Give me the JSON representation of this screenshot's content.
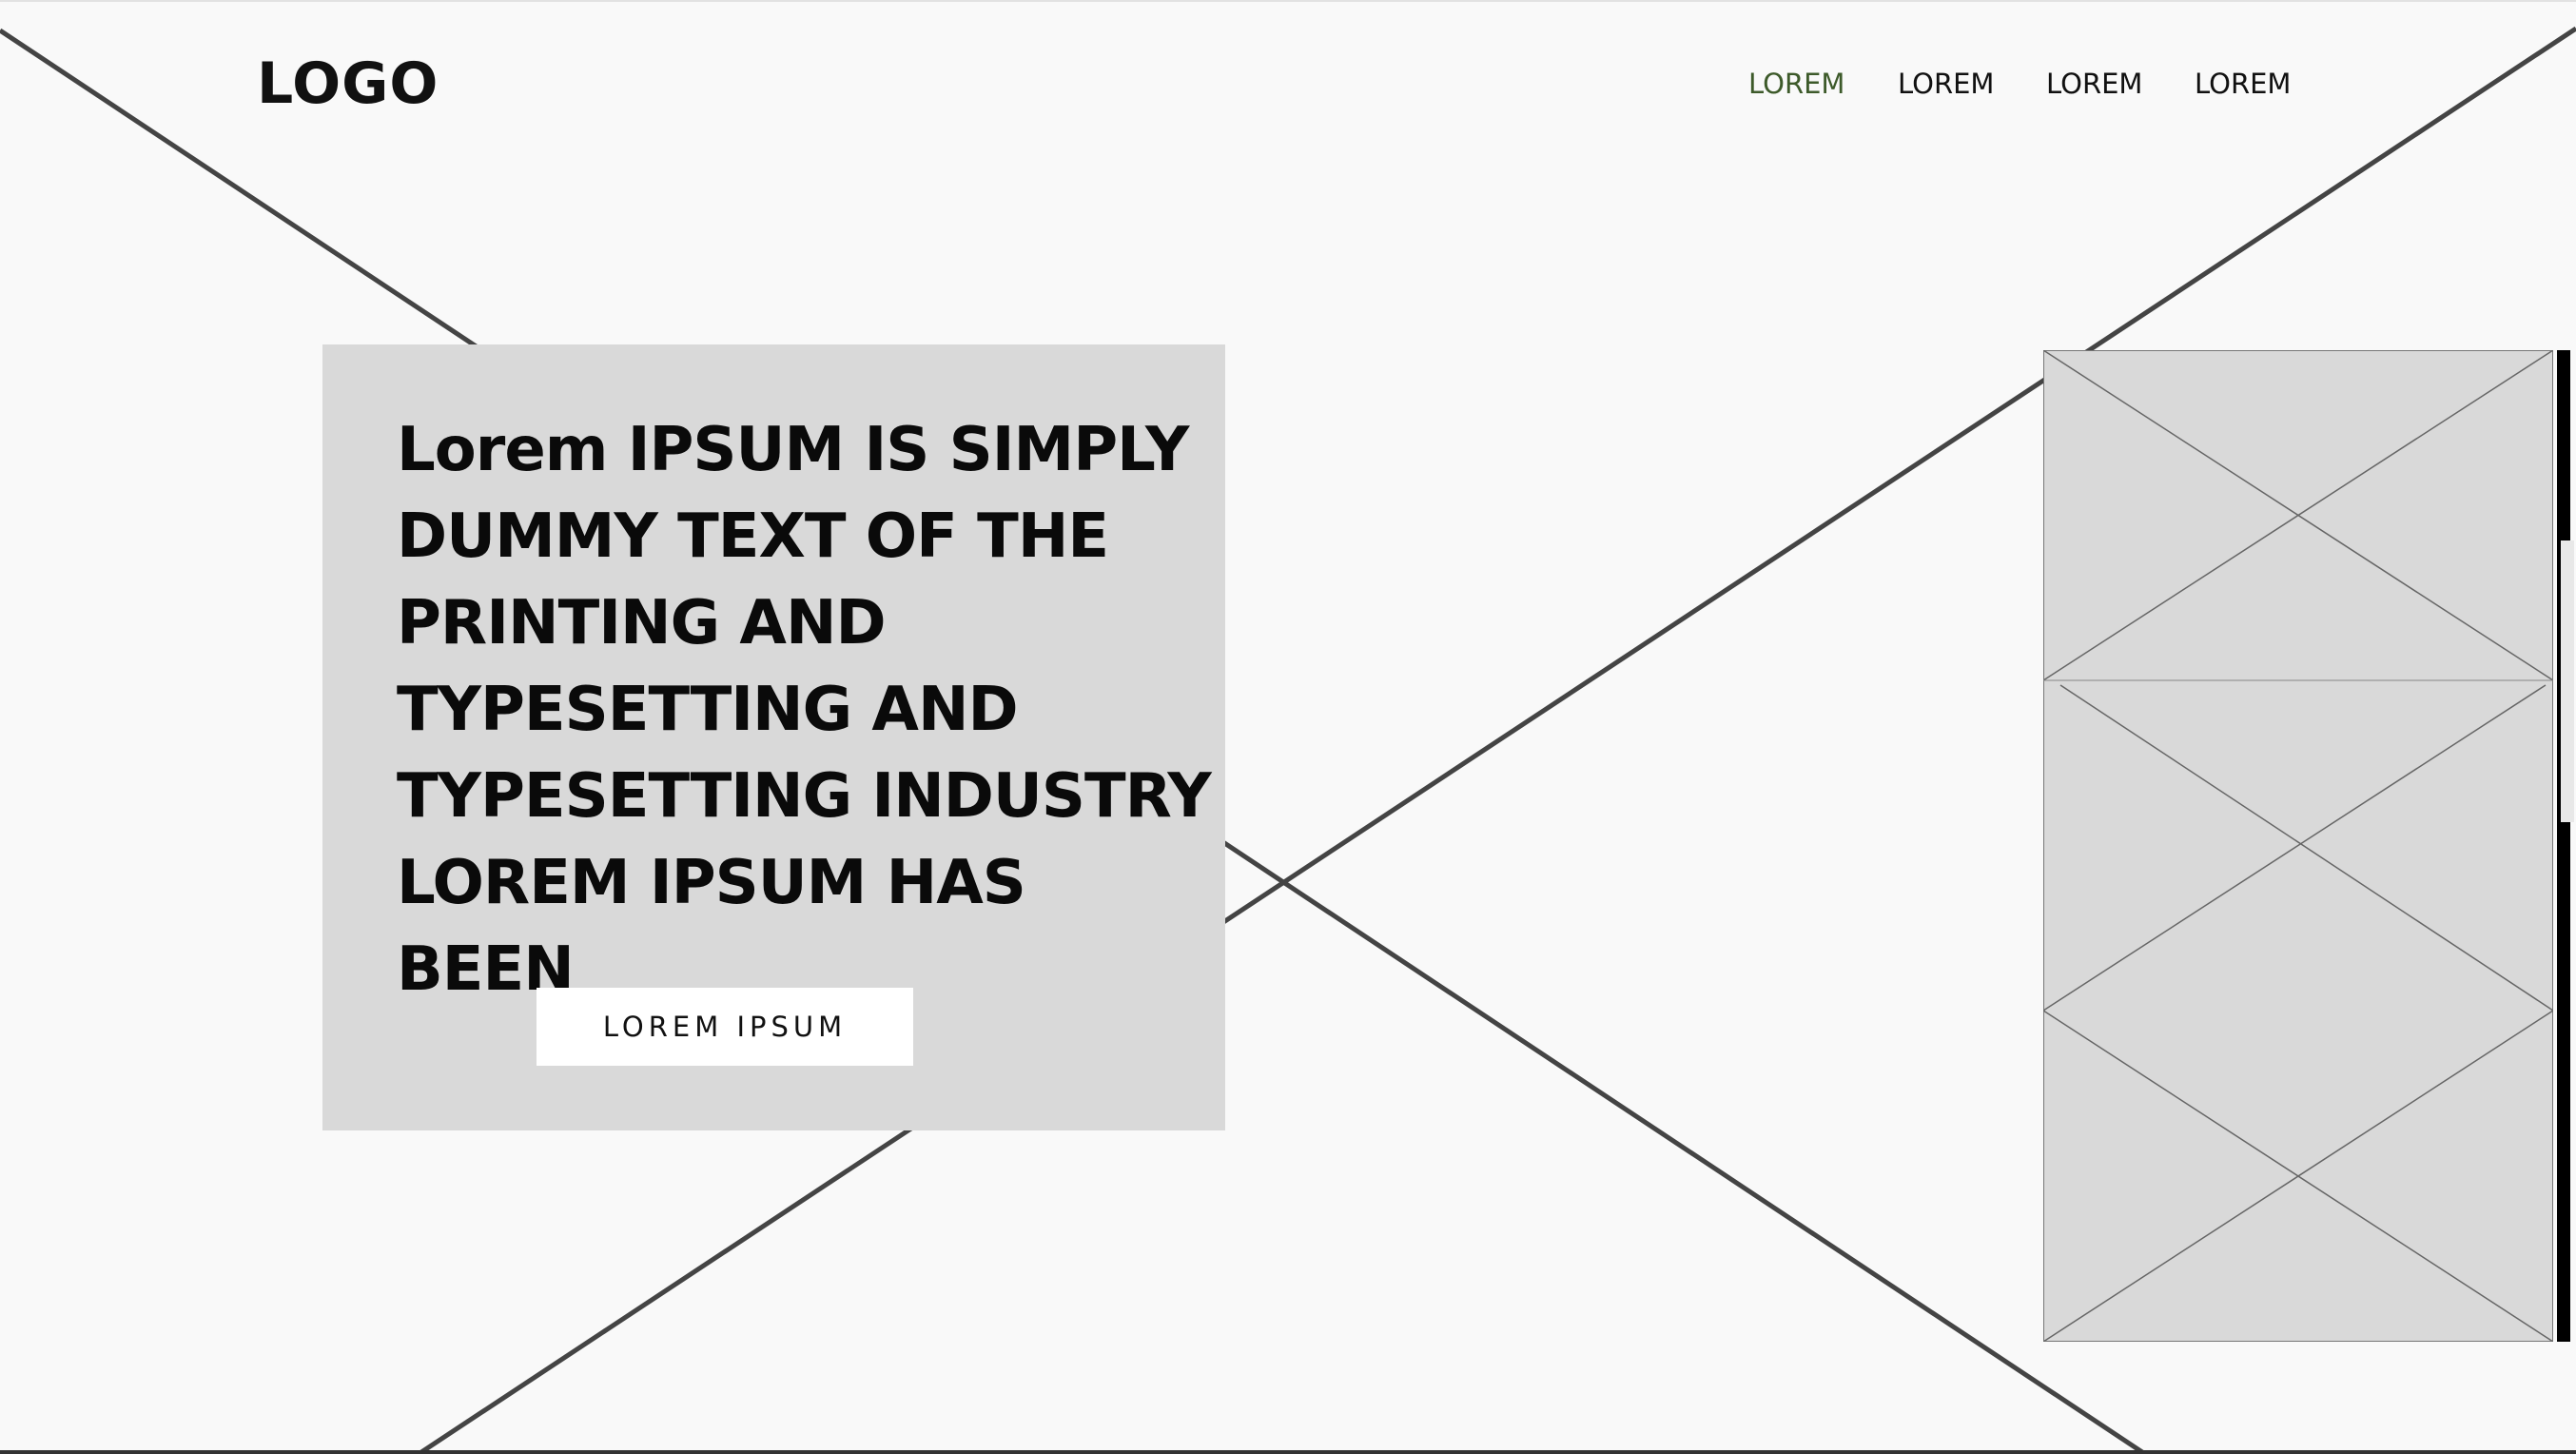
{
  "logo": {
    "text": "LOGO"
  },
  "nav": {
    "items": [
      {
        "label": "LOREM",
        "active": true
      },
      {
        "label": "LOREM",
        "active": false
      },
      {
        "label": "LOREM",
        "active": false
      },
      {
        "label": "LOREM",
        "active": false
      }
    ]
  },
  "hero": {
    "lines": [
      "Lorem IPSUM IS SIMPLY",
      "DUMMY TEXT OF THE",
      "PRINTING AND",
      "TYPESETTING AND",
      "TYPESETTING INDUSTRY",
      "LOREM IPSUM HAS BEEN"
    ],
    "button_label": "LOREM IPSUM"
  },
  "colors": {
    "background": "#f9f9f9",
    "hero_box": "#d9d9d9",
    "placeholder": "#d9d9d9",
    "active_nav": "#3d5a2a",
    "text": "#111111"
  },
  "icons": {
    "background": "image-placeholder-icon",
    "side_image": "image-placeholder-icon"
  }
}
